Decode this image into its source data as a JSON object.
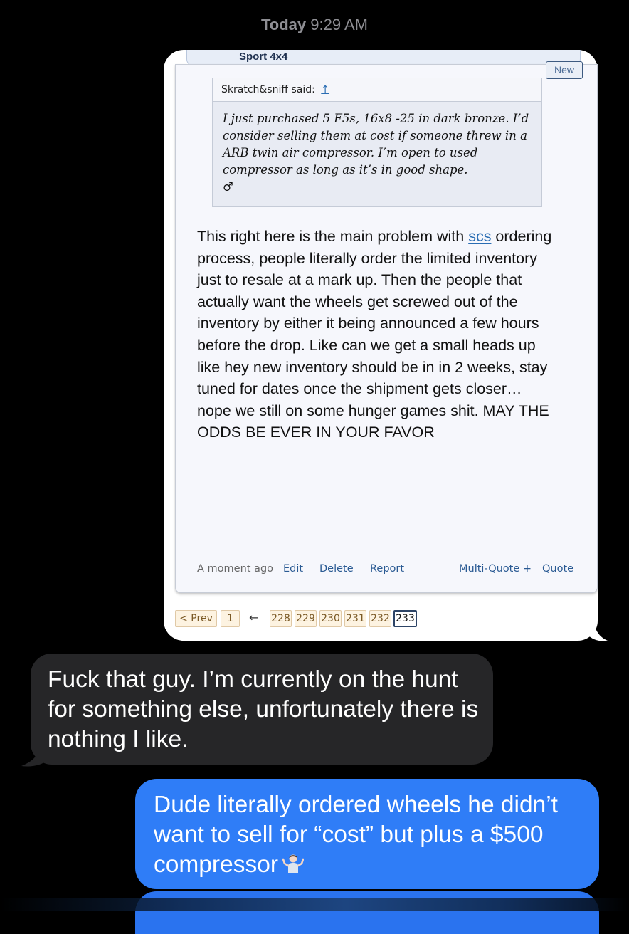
{
  "timestamp": {
    "day": "Today",
    "time": "9:29 AM"
  },
  "forum": {
    "section_title": "Sport 4x4",
    "new_badge": "New",
    "quote": {
      "author_said": "Skratch&sniff said:",
      "arrow": "↑",
      "body": "I just purchased 5 F5s, 16x8 -25 in dark bronze. I’d consider selling them at cost if someone threw in a ARB twin air compressor. I’m open to used compressor as long as it’s in good shape.",
      "symbol": "♂"
    },
    "post": {
      "text_before_link": "This right here is the main problem with ",
      "link_text": "scs",
      "text_after_link": " ordering process, people literally order the limited inventory just to resale at a mark up. Then the people that actually want the wheels get screwed out of the inventory by either it being announced a few hours before the drop. Like can we get a small heads up like hey new inventory should be in in 2 weeks, stay tuned for dates once the shipment gets closer… nope we still on some hunger games shit. MAY THE ODDS BE EVER IN YOUR FAVOR"
    },
    "footer": {
      "time": "A moment ago",
      "edit": "Edit",
      "delete": "Delete",
      "report": "Report",
      "multi_quote": "Multi-Quote +",
      "quote": "Quote"
    },
    "pagination": {
      "prev": "< Prev",
      "first": "1",
      "arrow": "←",
      "pages": [
        "228",
        "229",
        "230",
        "231",
        "232"
      ],
      "current": "233"
    }
  },
  "messages": {
    "incoming": "Fuck that guy. I’m currently on the hunt for something else, unfortunately there is nothing I like.",
    "outgoing": "Dude literally ordered wheels he didn’t want to sell for “cost” but plus a $500 compressor",
    "outgoing_emoji": "person-shrugging-icon"
  },
  "colors": {
    "background": "#000000",
    "blue_bubble": "#2f7df7",
    "gray_bubble": "#262628",
    "timestamp": "#8e8e93",
    "forum_link": "#2a6db3"
  }
}
